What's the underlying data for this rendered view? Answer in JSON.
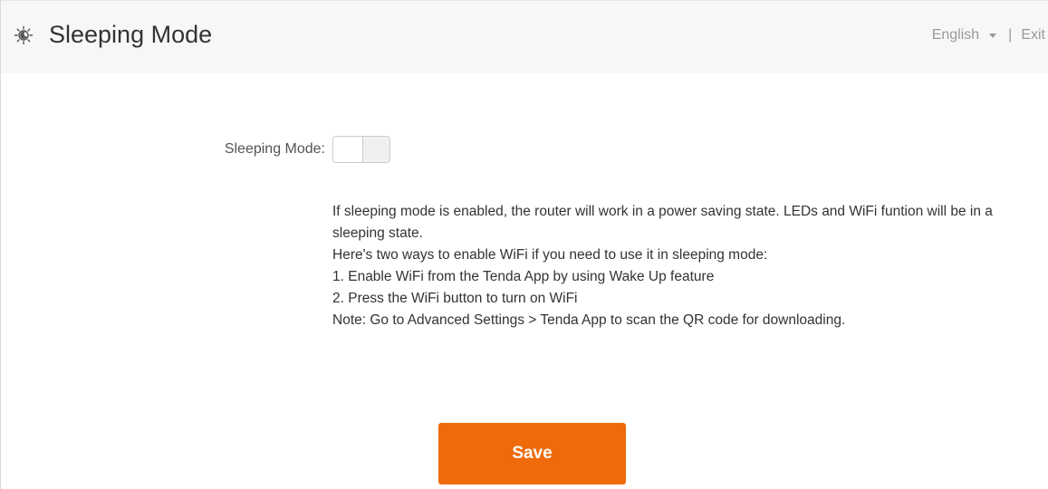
{
  "header": {
    "title": "Sleeping Mode",
    "icon": "sleeping-mode-icon",
    "language": "English",
    "separator": "|",
    "exit_label": "Exit"
  },
  "form": {
    "sleeping_mode_label": "Sleeping Mode:",
    "sleeping_mode_enabled": false
  },
  "description": [
    "If sleeping mode is enabled, the router will work in a power saving state. LEDs and WiFi funtion will be in a sleeping state.",
    "Here's two ways to enable WiFi if you need to use it in sleeping mode:",
    "1. Enable WiFi from the Tenda App by using Wake Up feature",
    "2. Press the WiFi button to turn on WiFi",
    "Note: Go to Advanced Settings > Tenda App to scan the QR code for downloading."
  ],
  "actions": {
    "save_label": "Save"
  },
  "colors": {
    "accent": "#ef6a0a",
    "header_bg": "#f7f7f7",
    "muted_text": "#999999"
  }
}
